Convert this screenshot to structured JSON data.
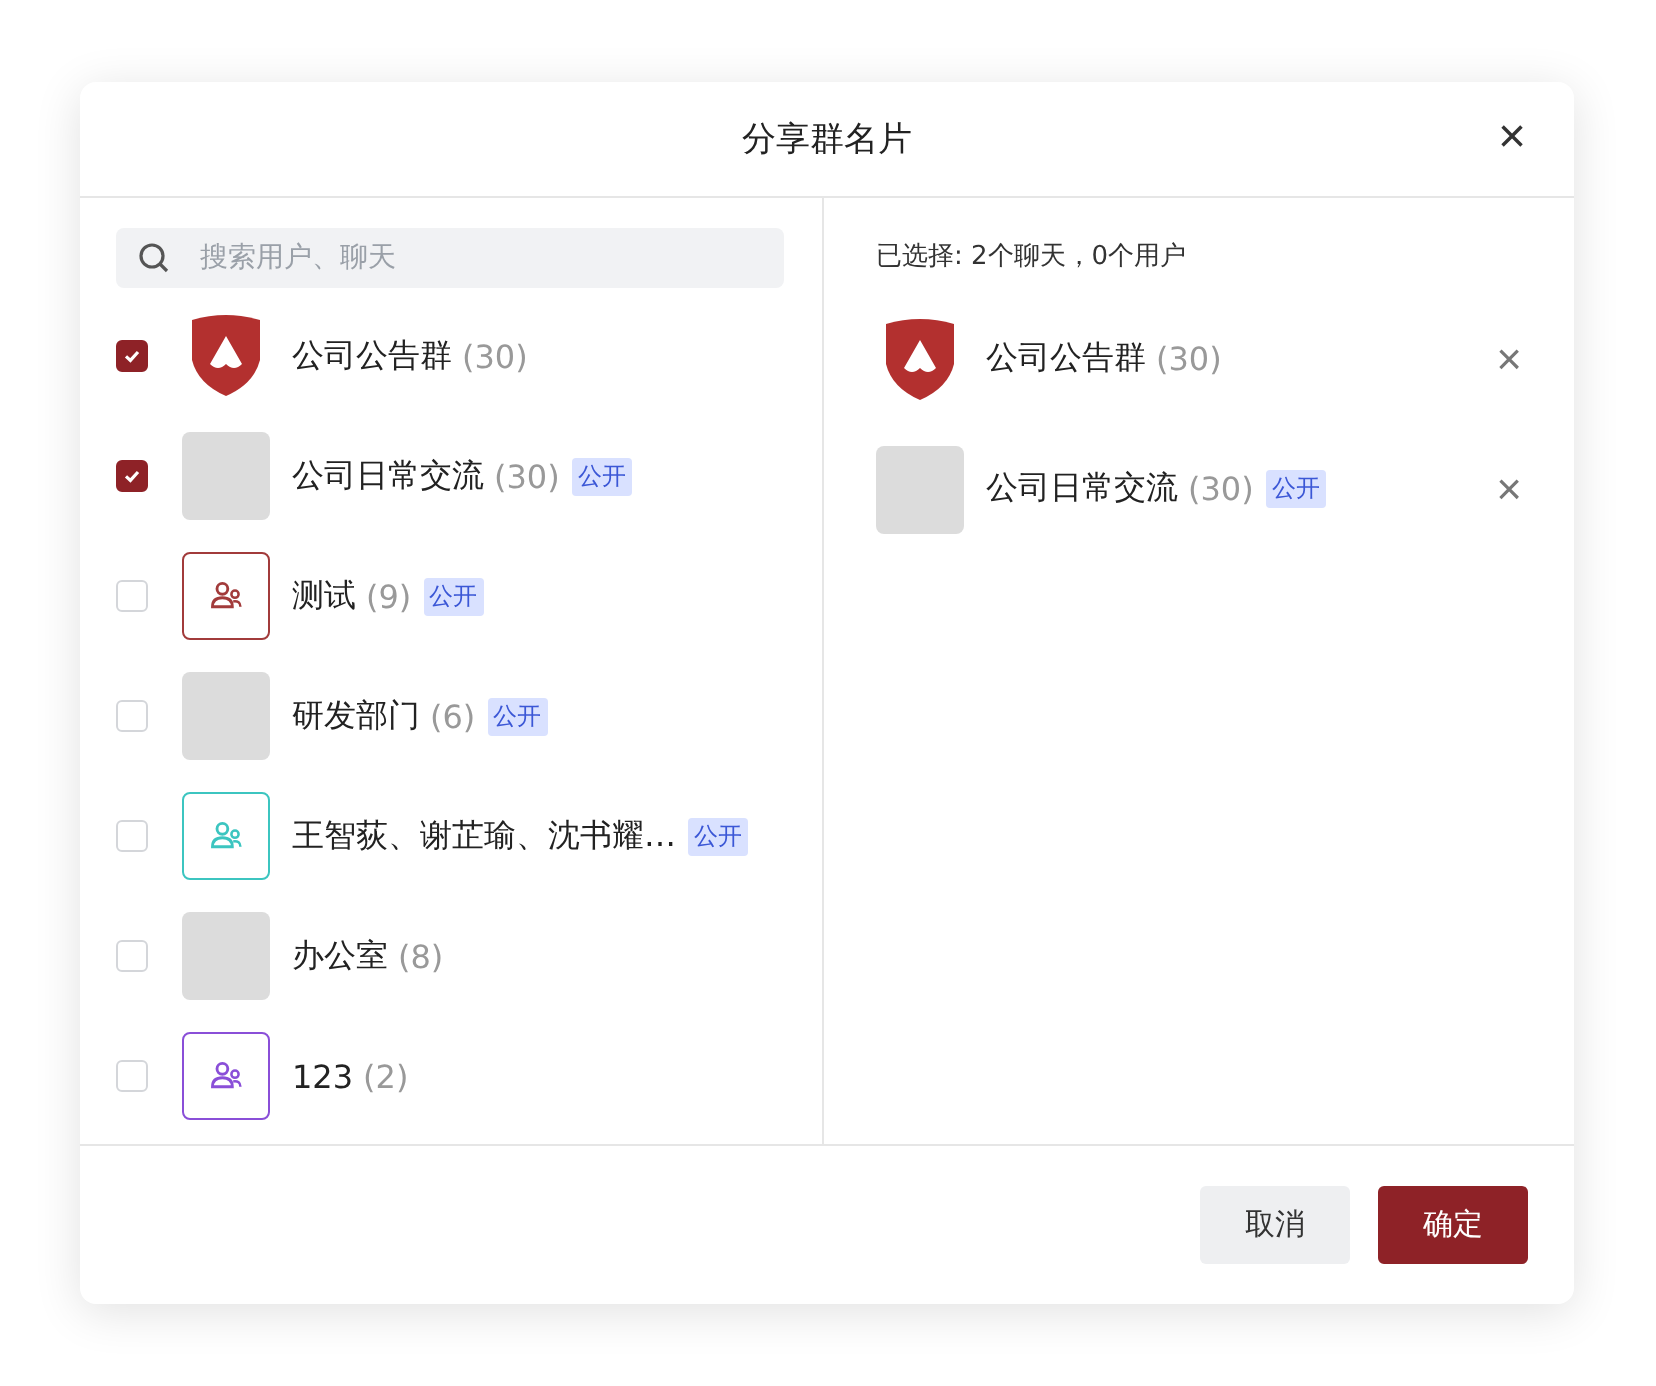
{
  "dialog": {
    "title": "分享群名片",
    "close": "×"
  },
  "search": {
    "placeholder": "搜索用户、聊天"
  },
  "chats": [
    {
      "name": "公司公告群",
      "count": "(30)",
      "checked": true,
      "kind": "shield"
    },
    {
      "name": "公司日常交流",
      "count": "(30)",
      "tag": "公开",
      "checked": true,
      "kind": "photos"
    },
    {
      "name": "测试",
      "count": "(9)",
      "tag": "公开",
      "checked": false,
      "kind": "group",
      "color": "#a23b3b"
    },
    {
      "name": "研发部门",
      "count": "(6)",
      "tag": "公开",
      "checked": false,
      "kind": "photos"
    },
    {
      "name": "王智荻、谢芷瑜、沈书耀…",
      "tag": "公开",
      "checked": false,
      "kind": "group",
      "color": "#3cc5c0"
    },
    {
      "name": "办公室",
      "count": "(8)",
      "checked": false,
      "kind": "photos"
    },
    {
      "name": "123",
      "count": "(2)",
      "checked": false,
      "kind": "group",
      "color": "#8a4fd8"
    }
  ],
  "selected_summary": "已选择: 2个聊天，0个用户",
  "selected": [
    {
      "name": "公司公告群",
      "count": "(30)",
      "kind": "shield",
      "remove": "×"
    },
    {
      "name": "公司日常交流",
      "count": "(30)",
      "tag": "公开",
      "kind": "photos",
      "remove": "×"
    }
  ],
  "buttons": [
    {
      "label": "取消",
      "kind": "secondary"
    },
    {
      "label": "确定",
      "kind": "primary"
    }
  ]
}
